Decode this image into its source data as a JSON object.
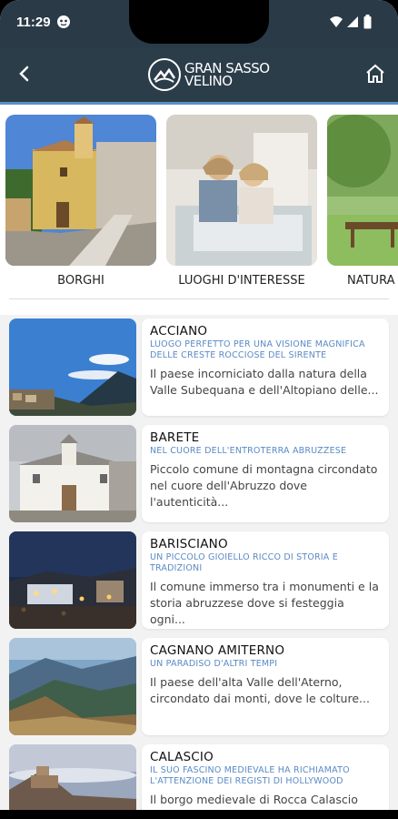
{
  "status": {
    "time": "11:29"
  },
  "appbar": {
    "logo_line1": "GRAN SASSO",
    "logo_line2": "VELINO"
  },
  "categories": [
    {
      "label": "BORGHI"
    },
    {
      "label": "LUOGHI D'INTERESSE"
    },
    {
      "label": "NATURA"
    }
  ],
  "places": [
    {
      "title": "ACCIANO",
      "subtitle": "LUOGO PERFETTO PER UNA VISIONE MAGNIFICA DELLE CRESTE ROCCIOSE DEL SIRENTE",
      "desc": "Il paese incorniciato dalla natura della Valle Subequana e dell'Altopiano delle..."
    },
    {
      "title": "BARETE",
      "subtitle": "NEL CUORE DELL'ENTROTERRA ABRUZZESE",
      "desc": "Piccolo comune di montagna circondato nel cuore dell'Abruzzo dove l'autenticità..."
    },
    {
      "title": "BARISCIANO",
      "subtitle": "UN PICCOLO GIOIELLO RICCO DI STORIA E TRADIZIONI",
      "desc": "Il comune immerso tra i monumenti e la storia abruzzese dove si festeggia ogni..."
    },
    {
      "title": "CAGNANO AMITERNO",
      "subtitle": "UN PARADISO D'ALTRI TEMPI",
      "desc": "Il paese dell'alta Valle dell'Aterno, circondato dai monti, dove le colture..."
    },
    {
      "title": "CALASCIO",
      "subtitle": "IL SUO FASCINO MEDIEVALE HA RICHIAMATO L'ATTENZIONE DEI REGISTI DI HOLLYWOOD",
      "desc": "Il borgo medievale di Rocca Calascio nel..."
    }
  ]
}
